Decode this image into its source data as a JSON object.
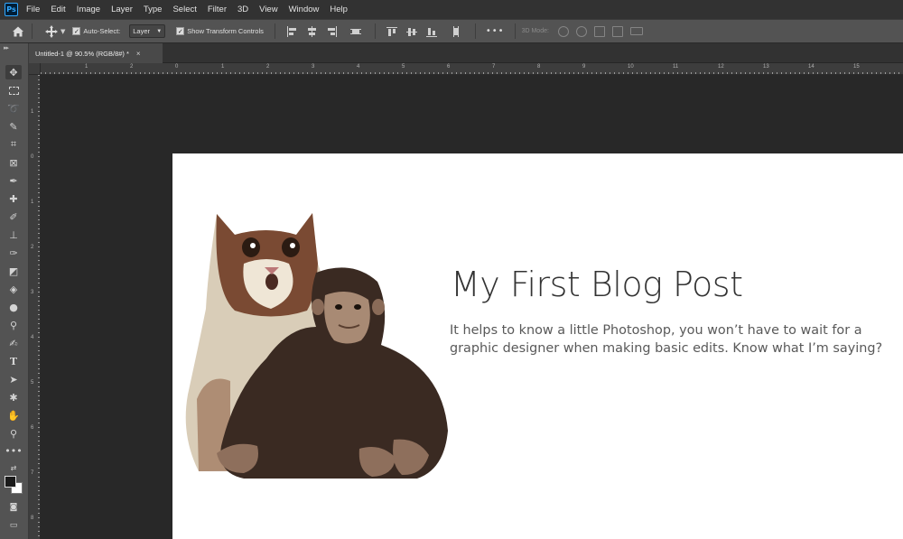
{
  "app": {
    "logo_text": "Ps",
    "menu": [
      "File",
      "Edit",
      "Image",
      "Layer",
      "Type",
      "Select",
      "Filter",
      "3D",
      "View",
      "Window",
      "Help"
    ]
  },
  "options": {
    "auto_select_label": "Auto-Select:",
    "auto_select_checked": true,
    "auto_select_target": "Layer",
    "show_transform_label": "Show Transform Controls",
    "show_transform_checked": true,
    "more_label": "•••",
    "mode_3d_label": "3D Mode:"
  },
  "document": {
    "tab_title": "Untitled-1 @ 90.5% (RGB/8#) *",
    "close_glyph": "×"
  },
  "ruler": {
    "top_labels": [
      "1",
      "2",
      "1",
      "0",
      "1",
      "2",
      "3",
      "4",
      "5",
      "6",
      "7",
      "8",
      "9",
      "10",
      "11",
      "12",
      "13",
      "14",
      "15"
    ],
    "left_labels": [
      "1",
      "0",
      "1",
      "2",
      "3",
      "4",
      "5",
      "6",
      "7",
      "8"
    ]
  },
  "tools": [
    "move-tool",
    "marquee-tool",
    "lasso-tool",
    "quick-select-tool",
    "crop-tool",
    "frame-tool",
    "eyedropper-tool",
    "healing-tool",
    "brush-tool",
    "stamp-tool",
    "history-brush-tool",
    "eraser-tool",
    "paint-bucket-tool",
    "blur-tool",
    "dodge-tool",
    "pen-tool",
    "type-tool",
    "path-select-tool",
    "shape-tool",
    "hand-tool",
    "zoom-tool",
    "more-tools",
    "swap-colors",
    "color-swatches",
    "quick-mask",
    "screen-mode"
  ],
  "canvas": {
    "title": "My First Blog Post",
    "body": "It helps to know a little Photoshop, you won’t have to wait for a graphic designer when making basic edits. Know what I’m saying?",
    "bg_color": "#ffffff",
    "title_color": "#333333",
    "body_color": "#595959"
  },
  "colors": {
    "app_bg": "#282828",
    "panel": "#535353",
    "menubar": "#323232",
    "accent_ps": "#31a8ff"
  }
}
